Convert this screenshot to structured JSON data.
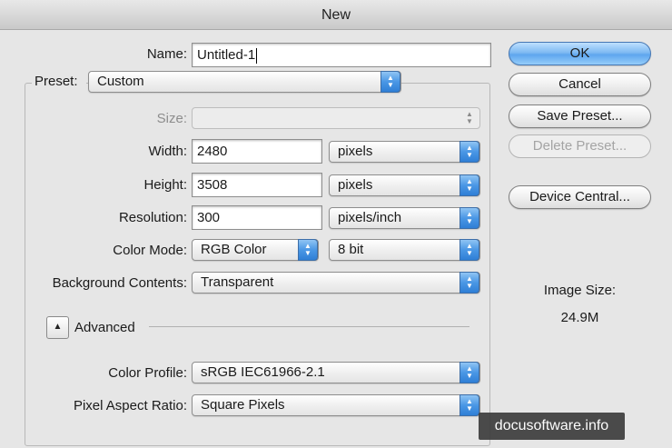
{
  "window": {
    "title": "New"
  },
  "form": {
    "name_label": "Name:",
    "name_value": "Untitled-1",
    "preset_label": "Preset:",
    "preset_value": "Custom",
    "size_label": "Size:",
    "size_value": "",
    "width_label": "Width:",
    "width_value": "2480",
    "width_unit": "pixels",
    "height_label": "Height:",
    "height_value": "3508",
    "height_unit": "pixels",
    "resolution_label": "Resolution:",
    "resolution_value": "300",
    "resolution_unit": "pixels/inch",
    "color_mode_label": "Color Mode:",
    "color_mode_value": "RGB Color",
    "bit_depth_value": "8 bit",
    "background_label": "Background Contents:",
    "background_value": "Transparent"
  },
  "advanced": {
    "toggle_label": "Advanced",
    "color_profile_label": "Color Profile:",
    "color_profile_value": "sRGB IEC61966-2.1",
    "pixel_aspect_label": "Pixel Aspect Ratio:",
    "pixel_aspect_value": "Square Pixels"
  },
  "buttons": {
    "ok": "OK",
    "cancel": "Cancel",
    "save_preset": "Save Preset...",
    "delete_preset": "Delete Preset...",
    "device_central": "Device Central..."
  },
  "info": {
    "image_size_label": "Image Size:",
    "image_size_value": "24.9M"
  },
  "watermark": "docusoftware.info",
  "colors": {
    "accent": "#5ea6ee",
    "dialog_bg": "#e6e6e6"
  },
  "icons": {
    "select_arrows": "up-down-arrows-icon",
    "advanced_toggle": "triangle-up-icon"
  }
}
